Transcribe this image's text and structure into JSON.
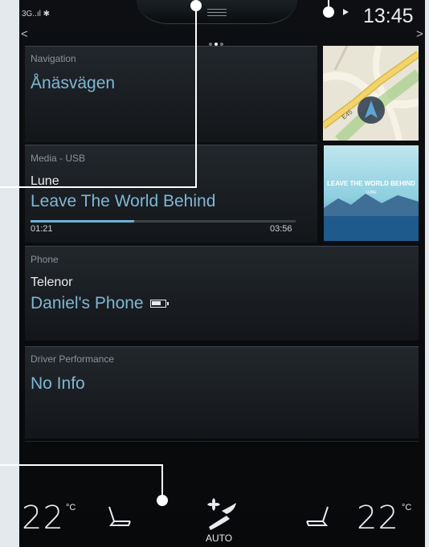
{
  "status": {
    "signal": "3G..ıl ✱",
    "time": "13:45",
    "page_count": 3,
    "active_page": 1
  },
  "navigation": {
    "title": "Navigation",
    "street": "Ånäsvägen",
    "map_label": "E45"
  },
  "media": {
    "title": "Media - USB",
    "artist": "Lune",
    "track": "Leave The World Behind",
    "elapsed": "01:21",
    "duration": "03:56",
    "progress_fraction": 0.39,
    "album_art_text": "LEAVE THE WORLD BEHIND",
    "album_art_subtext": "LUNE"
  },
  "phone": {
    "title": "Phone",
    "carrier": "Telenor",
    "device": "Daniel's Phone"
  },
  "driver": {
    "title": "Driver Performance",
    "value": "No Info"
  },
  "climate": {
    "left_temp": "22",
    "left_unit": "°C",
    "right_temp": "22",
    "right_unit": "°C",
    "mode": "AUTO"
  },
  "colors": {
    "accent": "#7fb7d4",
    "progress": "#6fb3d6",
    "background": "#0b0d10"
  }
}
